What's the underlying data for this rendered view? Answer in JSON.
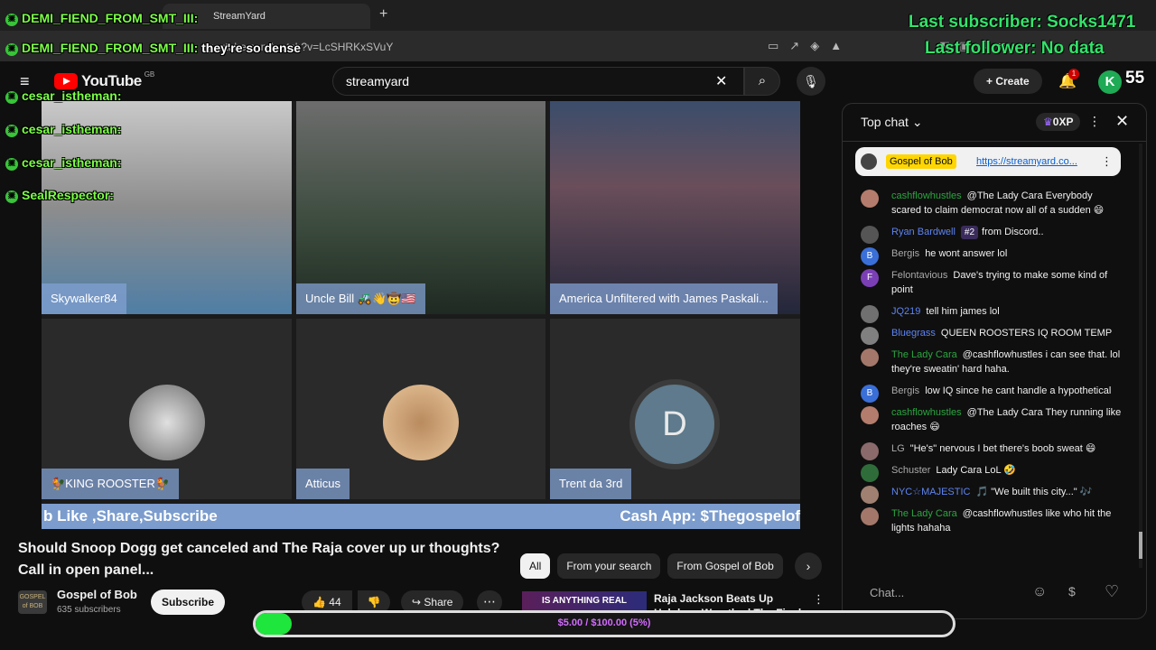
{
  "browser": {
    "tab_title": "StreamYard",
    "new_tab_icon": "plus-icon",
    "url": "youtube.com/watch?v=LcSHRKxSVuY"
  },
  "header": {
    "logo": "YouTube",
    "region": "GB",
    "search_value": "streamyard",
    "create_label": "Create",
    "notification_count": "1",
    "avatar_letter": "K"
  },
  "video": {
    "tiles": [
      {
        "name": "Skywalker84"
      },
      {
        "name": "Uncle Bill 🚜👋🤠🇺🇸"
      },
      {
        "name": "America Unfiltered with James Paskali..."
      },
      {
        "name": "🐓KING ROOSTER🐓"
      },
      {
        "name": "Atticus"
      },
      {
        "name": "Trent da 3rd",
        "initial": "D"
      }
    ],
    "ticker_left": "b Like ,Share,Subscribe",
    "ticker_right": "Cash App: $Thegospelof"
  },
  "meta": {
    "title": "Should Snoop Dogg get canceled and The Raja cover up ur thoughts? Call in open panel...",
    "channel_avatar_text": "GOSPEL of BOB",
    "channel": "Gospel of Bob",
    "subscribers": "635 subscribers",
    "subscribe_label": "Subscribe",
    "likes": "44",
    "share_label": "Share",
    "more_label": "⋯"
  },
  "chips": {
    "items": [
      "All",
      "From your search",
      "From Gospel of Bob"
    ],
    "active": 0
  },
  "recommendation": {
    "thumb_text": "IS ANYTHING REAL ANYMORE?",
    "title": "Raja Jackson Beats Up Helpless Wrestler | The Final Debate"
  },
  "chat": {
    "title": "Top chat",
    "xp": "0XP",
    "pinned": {
      "name": "Gospel of Bob",
      "link": "https://streamyard.co..."
    },
    "messages": [
      {
        "author": "cashflowhustles",
        "style": "green",
        "text": "@The Lady Cara Everybody scared to claim democrat now all of a sudden 😄",
        "avatar_color": "#b47c6c"
      },
      {
        "author": "Ryan Bardwell",
        "style": "blue",
        "badge": "#2",
        "text": "from Discord..",
        "avatar_color": "#555555"
      },
      {
        "author": "Bergis",
        "style": "",
        "text": "he wont answer lol",
        "avatar_color": "#3a6fd8",
        "initial": "B"
      },
      {
        "author": "Felontavious",
        "style": "",
        "text": "Dave's trying to make some kind of point",
        "avatar_color": "#7b3fb5",
        "initial": "F"
      },
      {
        "author": "JQ219",
        "style": "blue",
        "text": "tell him james lol",
        "avatar_color": "#707070"
      },
      {
        "author": "Bluegrass",
        "style": "blue",
        "text": "QUEEN ROOSTERS IQ ROOM TEMP",
        "avatar_color": "#808080"
      },
      {
        "author": "The Lady Cara",
        "style": "green",
        "text": "@cashflowhustles i can see that. lol they're sweatin' hard haha.",
        "avatar_color": "#a3786a"
      },
      {
        "author": "Bergis",
        "style": "",
        "text": "low IQ since he cant handle a hypothetical",
        "avatar_color": "#3a6fd8",
        "initial": "B"
      },
      {
        "author": "cashflowhustles",
        "style": "green",
        "text": "@The Lady Cara They running like roaches 😄",
        "avatar_color": "#b47c6c"
      },
      {
        "author": "LG",
        "style": "",
        "text": "\"He's\" nervous I bet there's boob sweat 😄",
        "avatar_color": "#8a6a6a"
      },
      {
        "author": "Schuster",
        "style": "",
        "text": "Lady Cara LoL 🤣",
        "avatar_color": "#2e6d3a"
      },
      {
        "author": "NYC☆MAJESTIC",
        "style": "blue",
        "text": "🎵 \"We built this city...\" 🎶",
        "avatar_color": "#a08070"
      },
      {
        "author": "The Lady Cara",
        "style": "green",
        "text": "@cashflowhustles like who hit the lights hahaha",
        "avatar_color": "#a3786a"
      }
    ],
    "input_placeholder": "Chat..."
  },
  "overlay": {
    "alerts": [
      {
        "user": "DEMI_FIEND_FROM_SMT_III:",
        "message": ""
      },
      {
        "user": "DEMI_FIEND_FROM_SMT_III:",
        "message": "they're so dense"
      },
      {
        "user": "cesar_istheman:",
        "message": ""
      },
      {
        "user": "cesar_istheman:",
        "message": ""
      },
      {
        "user": "cesar_istheman:",
        "message": ""
      },
      {
        "user": "SealRespector:",
        "message": ""
      }
    ],
    "last_subscriber": "Last subscriber: Socks1471",
    "last_follower": "Last follower: No data",
    "count": "55",
    "goal_text": "$5.00 / $100.00 (5%)",
    "goal_fraction": 0.05
  },
  "colors": {
    "accent_green": "#33e36a",
    "yt_red": "#ff0000",
    "ticker_blue": "#7b9ccd"
  }
}
